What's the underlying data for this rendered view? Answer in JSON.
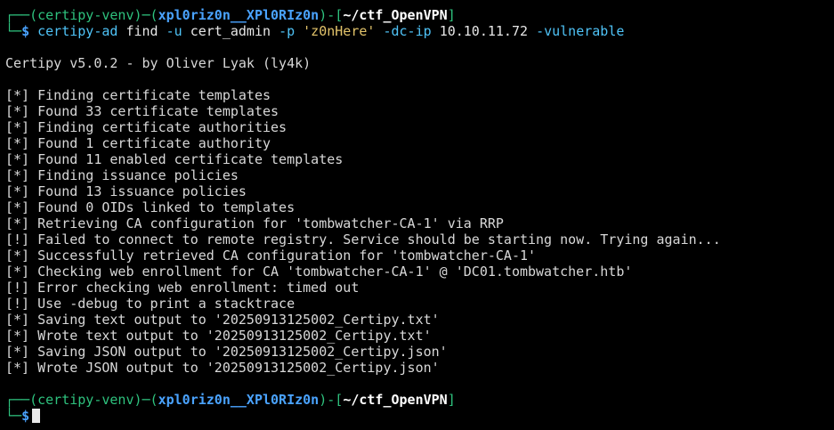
{
  "colors": {
    "background": "#000000",
    "prompt_frame": "#2ec27e",
    "user_host": "#4aa3ff",
    "path": "#ffffff",
    "command": "#4fc3f7",
    "string": "#e3c46b",
    "output": "#d8d8d8"
  },
  "prompt1": {
    "frame_open": "┌──(",
    "venv": "certipy-venv",
    "sep": ")─(",
    "user_host": "xpl0riz0n__XPl0RIz0n",
    "sep2": ")-[",
    "path": "~/ctf_OpenVPN",
    "frame_close": "]",
    "arrow": "└─",
    "dollar": "$",
    "command": {
      "bin": "certipy-ad",
      "sub": "find",
      "opt_u": "-u",
      "user": "cert_admin",
      "opt_p": "-p",
      "password": "'z0nHere'",
      "opt_dc": "-dc-ip",
      "ip": "10.10.11.72",
      "opt_vuln": "-vulnerable"
    }
  },
  "banner": "Certipy v5.0.2 - by Oliver Lyak (ly4k)",
  "output_lines": [
    "[*] Finding certificate templates",
    "[*] Found 33 certificate templates",
    "[*] Finding certificate authorities",
    "[*] Found 1 certificate authority",
    "[*] Found 11 enabled certificate templates",
    "[*] Finding issuance policies",
    "[*] Found 13 issuance policies",
    "[*] Found 0 OIDs linked to templates",
    "[*] Retrieving CA configuration for 'tombwatcher-CA-1' via RRP",
    "[!] Failed to connect to remote registry. Service should be starting now. Trying again...",
    "[*] Successfully retrieved CA configuration for 'tombwatcher-CA-1'",
    "[*] Checking web enrollment for CA 'tombwatcher-CA-1' @ 'DC01.tombwatcher.htb'",
    "[!] Error checking web enrollment: timed out",
    "[!] Use -debug to print a stacktrace",
    "[*] Saving text output to '20250913125002_Certipy.txt'",
    "[*] Wrote text output to '20250913125002_Certipy.txt'",
    "[*] Saving JSON output to '20250913125002_Certipy.json'",
    "[*] Wrote JSON output to '20250913125002_Certipy.json'"
  ],
  "prompt2": {
    "frame_open": "┌──(",
    "venv": "certipy-venv",
    "sep": ")─(",
    "user_host": "xpl0riz0n__XPl0RIz0n",
    "sep2": ")-[",
    "path": "~/ctf_OpenVPN",
    "frame_close": "]",
    "arrow": "└─",
    "dollar": "$"
  }
}
